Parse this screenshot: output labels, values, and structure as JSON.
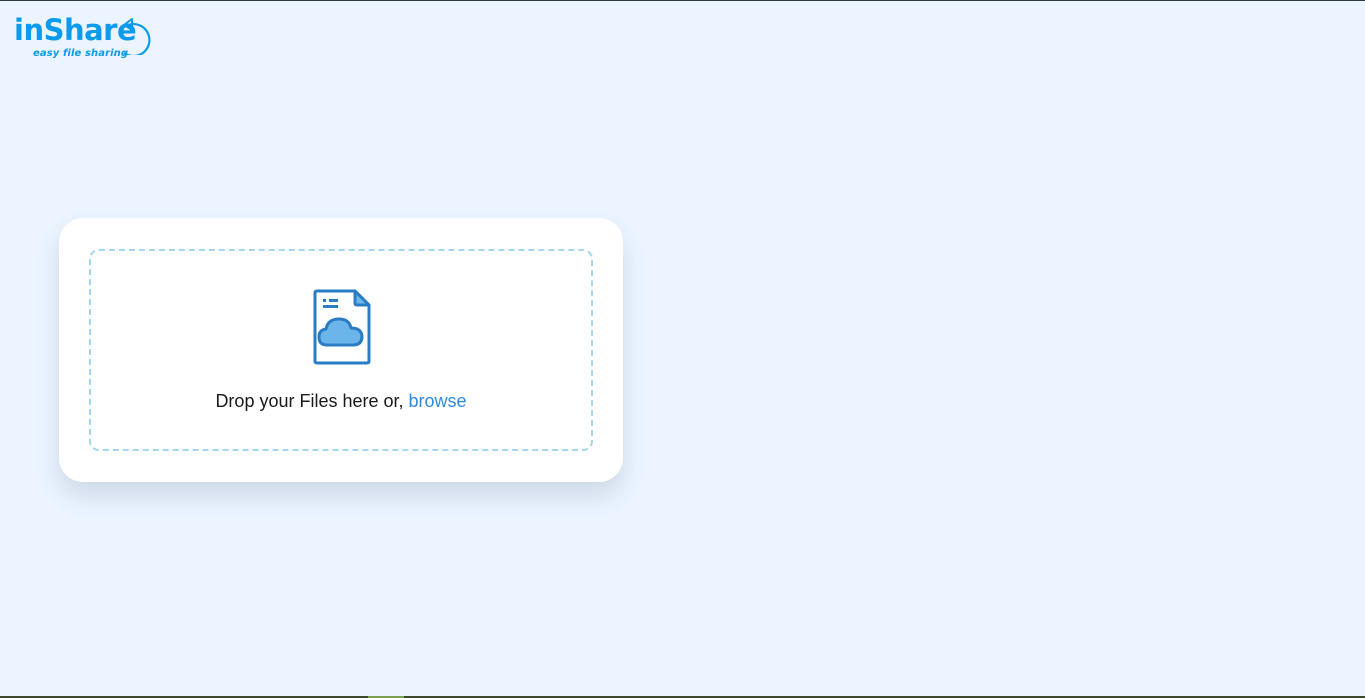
{
  "logo": {
    "brand": "inShare",
    "tagline": "easy file sharing",
    "icon": "circular-arrow-icon"
  },
  "upload": {
    "icon": "file-cloud-icon",
    "prompt": "Drop your Files here or,",
    "browse_label": "browse"
  },
  "colors": {
    "background": "#EBF4FF",
    "brand": "#0B9BEA",
    "link": "#2F8BE0",
    "dashed_border": "#A4D6EE",
    "icon_stroke": "#2A7DC4",
    "icon_fill": "#6CB5EA"
  }
}
